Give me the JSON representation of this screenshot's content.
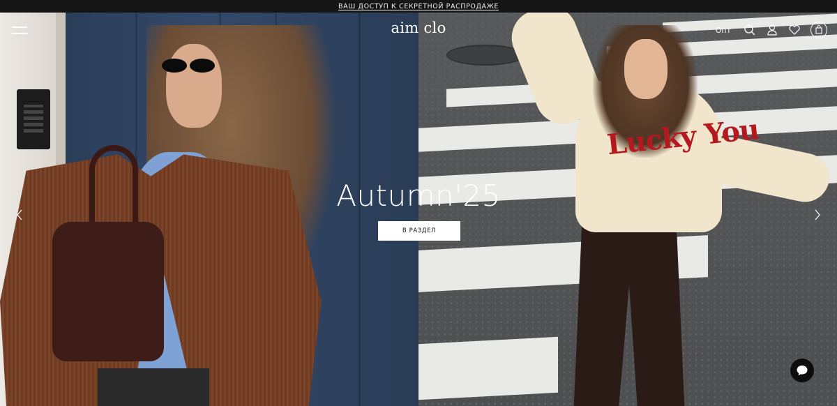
{
  "promo": {
    "text": "ВАШ ДОСТУП К СЕКРЕТНОЙ РАСПРОДАЖЕ"
  },
  "header": {
    "logo": "aim clo",
    "opt_label": "Опт",
    "icons": [
      "menu-icon",
      "search-icon",
      "user-icon",
      "heart-icon",
      "cart-icon"
    ]
  },
  "hero": {
    "title": "Autumn'25",
    "cta_label": "В РАЗДЕЛ",
    "sweater_print": "Lucky You",
    "nav": [
      "chevron-left-icon",
      "chevron-right-icon"
    ]
  },
  "chat": {
    "icon": "chat-bubble-icon"
  },
  "colors": {
    "promo_bg": "#151515",
    "text_light": "#ffffff",
    "cta_bg": "#ffffff",
    "chat_bg": "#0d0d0d"
  }
}
